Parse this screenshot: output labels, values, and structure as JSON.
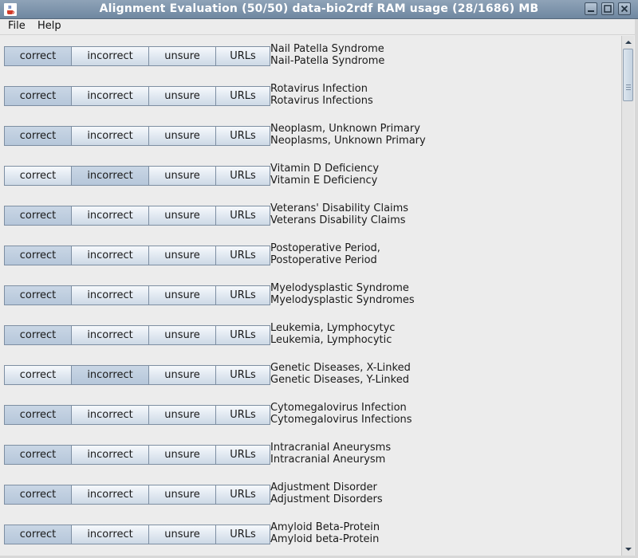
{
  "window": {
    "title": "Alignment Evaluation (50/50) data-bio2rdf RAM usage (28/1686) MB",
    "title_bar_color": "#7b91a8"
  },
  "menu": {
    "file": "File",
    "help": "Help"
  },
  "buttons": {
    "correct": "correct",
    "incorrect": "incorrect",
    "unsure": "unsure",
    "urls": "URLs"
  },
  "rows": [
    {
      "label1": "Nail Patella Syndrome",
      "label2": "Nail-Patella Syndrome",
      "selected": "correct"
    },
    {
      "label1": "Rotavirus Infection",
      "label2": "Rotavirus Infections",
      "selected": "correct"
    },
    {
      "label1": "Neoplasm, Unknown Primary",
      "label2": "Neoplasms, Unknown Primary",
      "selected": "correct"
    },
    {
      "label1": "Vitamin D Deficiency",
      "label2": "Vitamin E Deficiency",
      "selected": "incorrect"
    },
    {
      "label1": "Veterans' Disability Claims",
      "label2": "Veterans Disability Claims",
      "selected": "correct"
    },
    {
      "label1": "Postoperative Period,",
      "label2": "Postoperative Period",
      "selected": "correct"
    },
    {
      "label1": "Myelodysplastic Syndrome",
      "label2": "Myelodysplastic Syndromes",
      "selected": "correct"
    },
    {
      "label1": "Leukemia, Lymphocytyc",
      "label2": "Leukemia, Lymphocytic",
      "selected": "correct"
    },
    {
      "label1": "Genetic Diseases, X-Linked",
      "label2": "Genetic Diseases, Y-Linked",
      "selected": "incorrect"
    },
    {
      "label1": "Cytomegalovirus Infection",
      "label2": "Cytomegalovirus Infections",
      "selected": "correct"
    },
    {
      "label1": "Intracranial Aneurysms",
      "label2": "Intracranial Aneurysm",
      "selected": "correct"
    },
    {
      "label1": "Adjustment Disorder",
      "label2": "Adjustment Disorders",
      "selected": "correct"
    },
    {
      "label1": "Amyloid Beta-Protein",
      "label2": "Amyloid beta-Protein",
      "selected": "correct"
    }
  ],
  "scrollbar": {
    "position_fraction": 0.0
  },
  "icons": {
    "app": "java-cup-icon",
    "minimize": "minimize-icon",
    "maximize": "maximize-icon",
    "close": "close-icon",
    "scroll_up": "arrow-up-icon",
    "scroll_down": "arrow-down-icon"
  }
}
